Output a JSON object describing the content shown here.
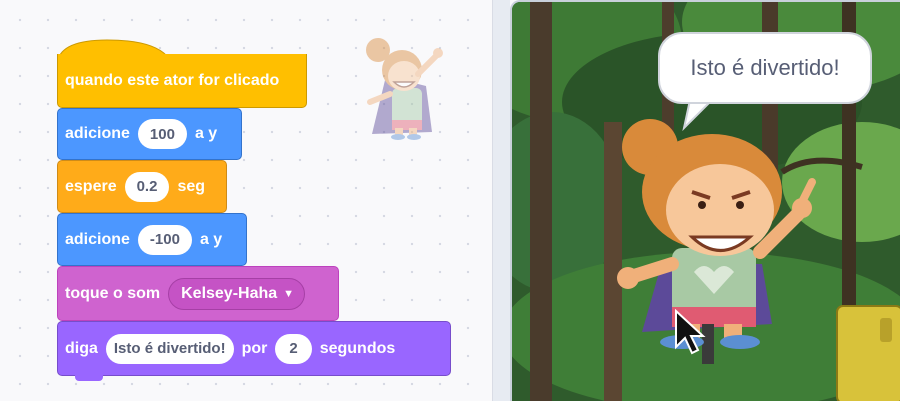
{
  "script": {
    "hat": {
      "label": "quando este ator for clicado"
    },
    "change_y_1": {
      "label": "adicione",
      "value": "100",
      "suffix": "a y"
    },
    "wait": {
      "label": "espere",
      "value": "0.2",
      "suffix": "seg"
    },
    "change_y_2": {
      "label": "adicione",
      "value": "-100",
      "suffix": "a y"
    },
    "play_sound": {
      "label": "toque o som",
      "sound": "Kelsey-Haha"
    },
    "say_for": {
      "label": "diga",
      "message": "Isto é divertido!",
      "mid": "por",
      "seconds": "2",
      "suffix": "segundos"
    }
  },
  "stage": {
    "speech_bubble": "Isto é divertido!"
  },
  "colors": {
    "events": "#ffbf00",
    "motion": "#4c97ff",
    "control": "#ffab19",
    "sound": "#cf63cf",
    "looks": "#9966ff"
  },
  "icons": [
    "sprite-thumbnail-icon",
    "dropdown-arrow-icon",
    "mouse-cursor-icon"
  ]
}
